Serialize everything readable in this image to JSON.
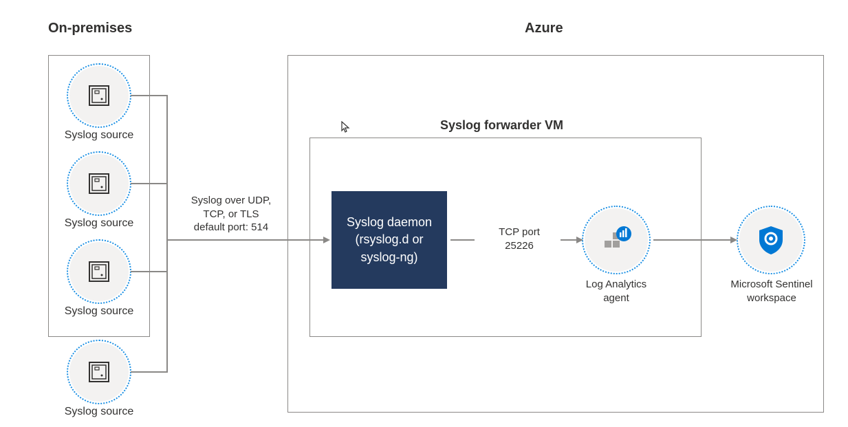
{
  "headings": {
    "onprem": "On-premises",
    "azure": "Azure"
  },
  "sources": {
    "label": "Syslog source"
  },
  "connection": {
    "label_line1": "Syslog over UDP,",
    "label_line2": "TCP, or TLS",
    "label_line3": "default port: 514"
  },
  "forwarder": {
    "title": "Syslog forwarder VM",
    "daemon_line1": "Syslog daemon",
    "daemon_line2": "(rsyslog.d or",
    "daemon_line3": "syslog-ng)",
    "port_line1": "TCP port",
    "port_line2": "25226",
    "agent_label_line1": "Log Analytics",
    "agent_label_line2": "agent"
  },
  "sentinel": {
    "label_line1": "Microsoft Sentinel",
    "label_line2": "workspace"
  },
  "chart_data": {
    "type": "diagram",
    "nodes": [
      {
        "id": "src1",
        "label": "Syslog source",
        "group": "On-premises"
      },
      {
        "id": "src2",
        "label": "Syslog source",
        "group": "On-premises"
      },
      {
        "id": "src3",
        "label": "Syslog source",
        "group": "On-premises"
      },
      {
        "id": "src4",
        "label": "Syslog source",
        "group": "On-premises"
      },
      {
        "id": "daemon",
        "label": "Syslog daemon (rsyslog.d or syslog-ng)",
        "group": "Syslog forwarder VM"
      },
      {
        "id": "agent",
        "label": "Log Analytics agent",
        "group": "Syslog forwarder VM"
      },
      {
        "id": "sentinel",
        "label": "Microsoft Sentinel workspace",
        "group": "Azure"
      }
    ],
    "edges": [
      {
        "from": "src1",
        "to": "daemon",
        "label": "Syslog over UDP, TCP, or TLS default port: 514"
      },
      {
        "from": "src2",
        "to": "daemon",
        "label": "Syslog over UDP, TCP, or TLS default port: 514"
      },
      {
        "from": "src3",
        "to": "daemon",
        "label": "Syslog over UDP, TCP, or TLS default port: 514"
      },
      {
        "from": "src4",
        "to": "daemon",
        "label": "Syslog over UDP, TCP, or TLS default port: 514"
      },
      {
        "from": "daemon",
        "to": "agent",
        "label": "TCP port 25226"
      },
      {
        "from": "agent",
        "to": "sentinel"
      }
    ],
    "groups": [
      {
        "name": "On-premises",
        "contains": [
          "src1",
          "src2",
          "src3",
          "src4"
        ]
      },
      {
        "name": "Azure",
        "contains": [
          "Syslog forwarder VM",
          "sentinel"
        ]
      },
      {
        "name": "Syslog forwarder VM",
        "contains": [
          "daemon",
          "agent"
        ]
      }
    ]
  }
}
